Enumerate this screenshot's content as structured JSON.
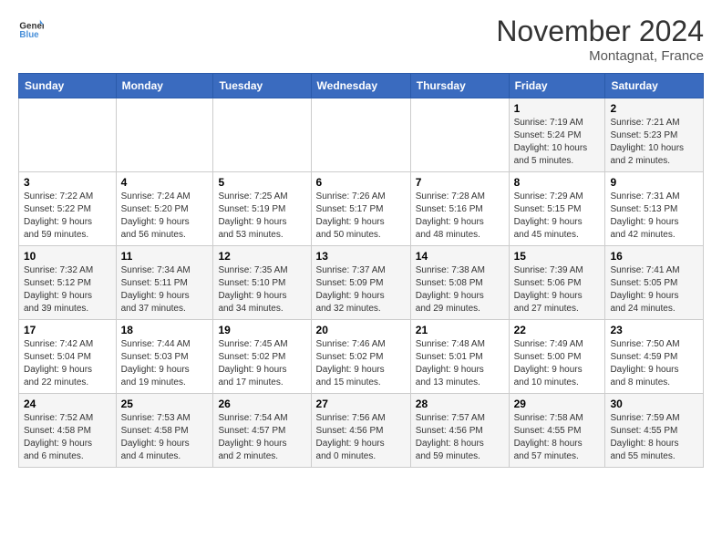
{
  "header": {
    "logo_line1": "General",
    "logo_line2": "Blue",
    "month": "November 2024",
    "location": "Montagnat, France"
  },
  "weekdays": [
    "Sunday",
    "Monday",
    "Tuesday",
    "Wednesday",
    "Thursday",
    "Friday",
    "Saturday"
  ],
  "weeks": [
    [
      {
        "day": "",
        "info": ""
      },
      {
        "day": "",
        "info": ""
      },
      {
        "day": "",
        "info": ""
      },
      {
        "day": "",
        "info": ""
      },
      {
        "day": "",
        "info": ""
      },
      {
        "day": "1",
        "info": "Sunrise: 7:19 AM\nSunset: 5:24 PM\nDaylight: 10 hours\nand 5 minutes."
      },
      {
        "day": "2",
        "info": "Sunrise: 7:21 AM\nSunset: 5:23 PM\nDaylight: 10 hours\nand 2 minutes."
      }
    ],
    [
      {
        "day": "3",
        "info": "Sunrise: 7:22 AM\nSunset: 5:22 PM\nDaylight: 9 hours\nand 59 minutes."
      },
      {
        "day": "4",
        "info": "Sunrise: 7:24 AM\nSunset: 5:20 PM\nDaylight: 9 hours\nand 56 minutes."
      },
      {
        "day": "5",
        "info": "Sunrise: 7:25 AM\nSunset: 5:19 PM\nDaylight: 9 hours\nand 53 minutes."
      },
      {
        "day": "6",
        "info": "Sunrise: 7:26 AM\nSunset: 5:17 PM\nDaylight: 9 hours\nand 50 minutes."
      },
      {
        "day": "7",
        "info": "Sunrise: 7:28 AM\nSunset: 5:16 PM\nDaylight: 9 hours\nand 48 minutes."
      },
      {
        "day": "8",
        "info": "Sunrise: 7:29 AM\nSunset: 5:15 PM\nDaylight: 9 hours\nand 45 minutes."
      },
      {
        "day": "9",
        "info": "Sunrise: 7:31 AM\nSunset: 5:13 PM\nDaylight: 9 hours\nand 42 minutes."
      }
    ],
    [
      {
        "day": "10",
        "info": "Sunrise: 7:32 AM\nSunset: 5:12 PM\nDaylight: 9 hours\nand 39 minutes."
      },
      {
        "day": "11",
        "info": "Sunrise: 7:34 AM\nSunset: 5:11 PM\nDaylight: 9 hours\nand 37 minutes."
      },
      {
        "day": "12",
        "info": "Sunrise: 7:35 AM\nSunset: 5:10 PM\nDaylight: 9 hours\nand 34 minutes."
      },
      {
        "day": "13",
        "info": "Sunrise: 7:37 AM\nSunset: 5:09 PM\nDaylight: 9 hours\nand 32 minutes."
      },
      {
        "day": "14",
        "info": "Sunrise: 7:38 AM\nSunset: 5:08 PM\nDaylight: 9 hours\nand 29 minutes."
      },
      {
        "day": "15",
        "info": "Sunrise: 7:39 AM\nSunset: 5:06 PM\nDaylight: 9 hours\nand 27 minutes."
      },
      {
        "day": "16",
        "info": "Sunrise: 7:41 AM\nSunset: 5:05 PM\nDaylight: 9 hours\nand 24 minutes."
      }
    ],
    [
      {
        "day": "17",
        "info": "Sunrise: 7:42 AM\nSunset: 5:04 PM\nDaylight: 9 hours\nand 22 minutes."
      },
      {
        "day": "18",
        "info": "Sunrise: 7:44 AM\nSunset: 5:03 PM\nDaylight: 9 hours\nand 19 minutes."
      },
      {
        "day": "19",
        "info": "Sunrise: 7:45 AM\nSunset: 5:02 PM\nDaylight: 9 hours\nand 17 minutes."
      },
      {
        "day": "20",
        "info": "Sunrise: 7:46 AM\nSunset: 5:02 PM\nDaylight: 9 hours\nand 15 minutes."
      },
      {
        "day": "21",
        "info": "Sunrise: 7:48 AM\nSunset: 5:01 PM\nDaylight: 9 hours\nand 13 minutes."
      },
      {
        "day": "22",
        "info": "Sunrise: 7:49 AM\nSunset: 5:00 PM\nDaylight: 9 hours\nand 10 minutes."
      },
      {
        "day": "23",
        "info": "Sunrise: 7:50 AM\nSunset: 4:59 PM\nDaylight: 9 hours\nand 8 minutes."
      }
    ],
    [
      {
        "day": "24",
        "info": "Sunrise: 7:52 AM\nSunset: 4:58 PM\nDaylight: 9 hours\nand 6 minutes."
      },
      {
        "day": "25",
        "info": "Sunrise: 7:53 AM\nSunset: 4:58 PM\nDaylight: 9 hours\nand 4 minutes."
      },
      {
        "day": "26",
        "info": "Sunrise: 7:54 AM\nSunset: 4:57 PM\nDaylight: 9 hours\nand 2 minutes."
      },
      {
        "day": "27",
        "info": "Sunrise: 7:56 AM\nSunset: 4:56 PM\nDaylight: 9 hours\nand 0 minutes."
      },
      {
        "day": "28",
        "info": "Sunrise: 7:57 AM\nSunset: 4:56 PM\nDaylight: 8 hours\nand 59 minutes."
      },
      {
        "day": "29",
        "info": "Sunrise: 7:58 AM\nSunset: 4:55 PM\nDaylight: 8 hours\nand 57 minutes."
      },
      {
        "day": "30",
        "info": "Sunrise: 7:59 AM\nSunset: 4:55 PM\nDaylight: 8 hours\nand 55 minutes."
      }
    ]
  ]
}
